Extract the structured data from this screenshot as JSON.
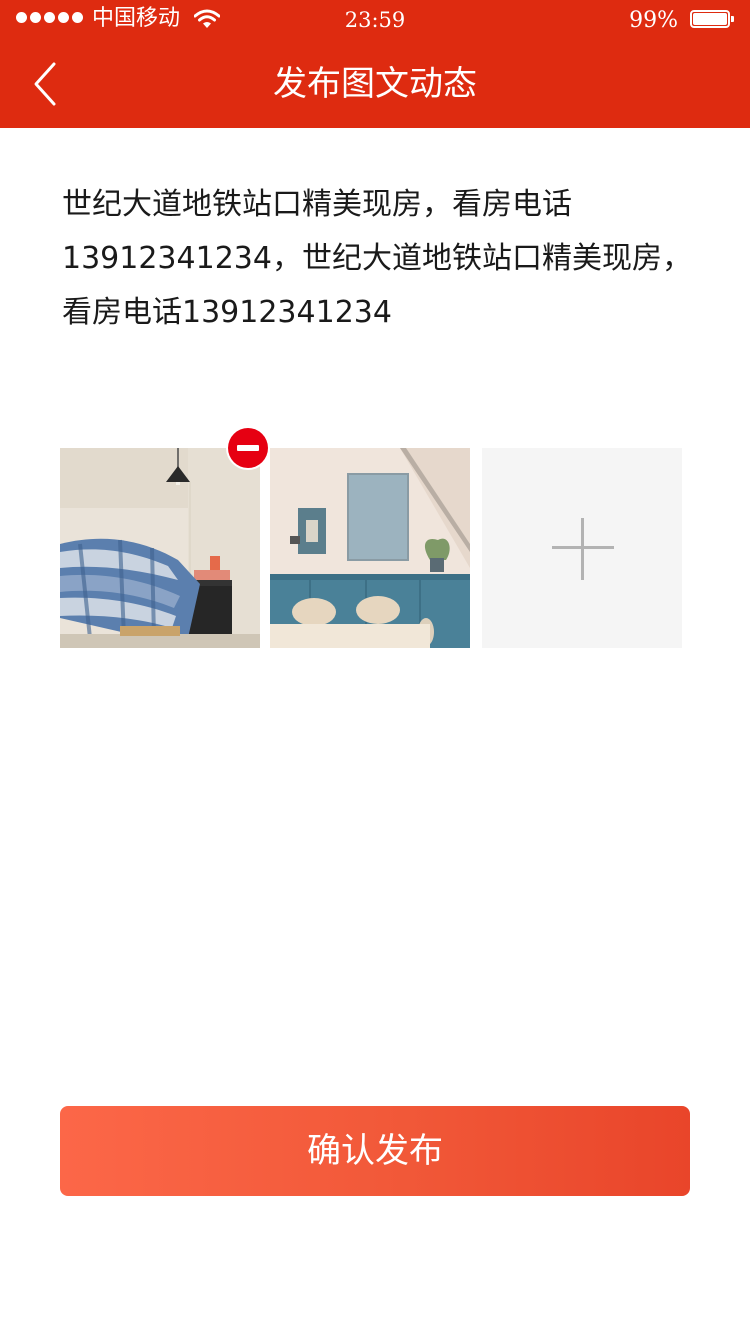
{
  "status_bar": {
    "carrier": "中国移动",
    "time": "23:59",
    "battery_percent": "99%",
    "battery_level": 0.99,
    "signal_bars": 5
  },
  "nav": {
    "title": "发布图文动态",
    "back_icon": "chevron-left-icon"
  },
  "post": {
    "text": "世纪大道地铁站口精美现房，看房电话13912341234，世纪大道地铁站口精美现房，看房电话13912341234"
  },
  "photos": {
    "items": [
      {
        "name": "bedroom-photo",
        "removable": true
      },
      {
        "name": "dining-room-photo",
        "removable": false
      }
    ],
    "add_icon": "plus-icon",
    "remove_icon": "minus-circle-icon"
  },
  "actions": {
    "confirm_label": "确认发布"
  },
  "colors": {
    "header": "#de2b10",
    "remove_badge": "#e60012",
    "button_start": "#fc6748",
    "button_end": "#e9452a"
  }
}
